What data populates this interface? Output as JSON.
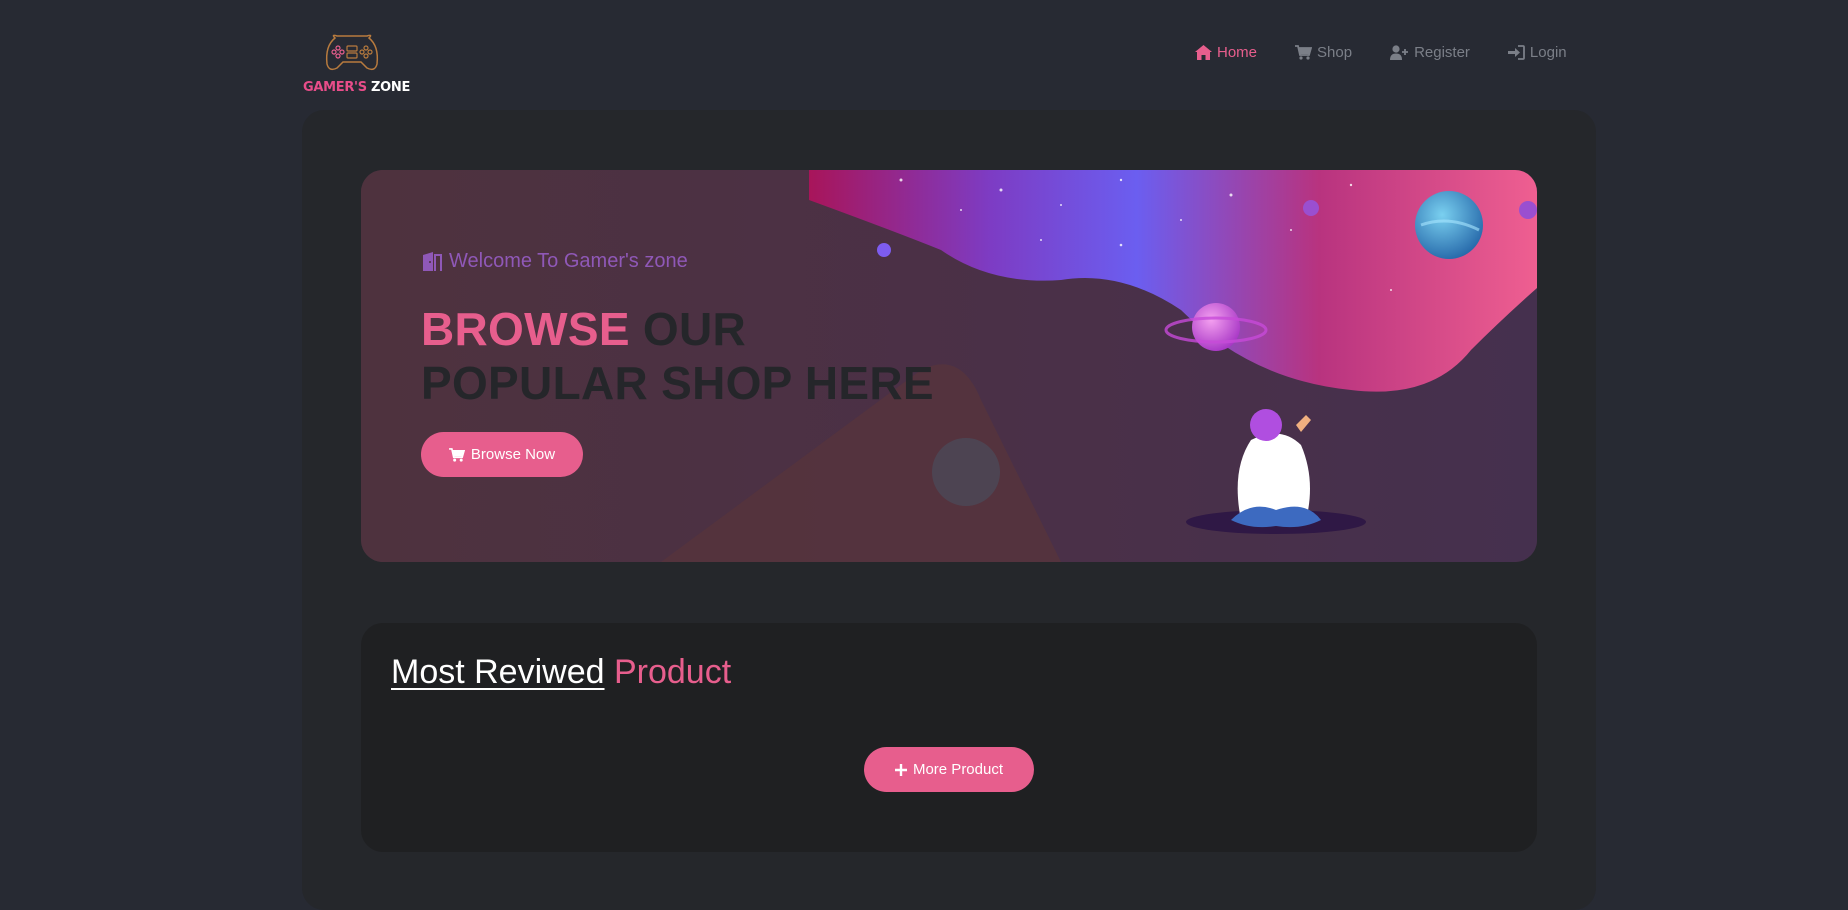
{
  "brand": {
    "logo_part1": "GAMER'S",
    "logo_part2": "ZONE",
    "accent": "#e75e8d"
  },
  "nav": {
    "items": [
      {
        "label": "Home",
        "icon": "home-icon",
        "active": true
      },
      {
        "label": "Shop",
        "icon": "cart-icon",
        "active": false
      },
      {
        "label": "Register",
        "icon": "user-plus-icon",
        "active": false
      },
      {
        "label": "Login",
        "icon": "sign-in-icon",
        "active": false
      }
    ]
  },
  "banner": {
    "welcome": "Welcome To Gamer's zone",
    "headline_pink": "BROWSE",
    "headline_rest": "OUR POPULAR SHOP HERE",
    "button": "Browse Now"
  },
  "reviewed": {
    "title_underlined": "Most Reviwed",
    "title_accent": "Product",
    "button": "More Product"
  }
}
